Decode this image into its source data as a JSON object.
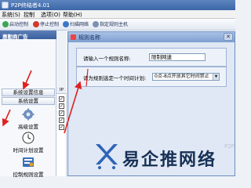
{
  "app": {
    "title": "P2P终结者4.01"
  },
  "menu": [
    "系统(S)",
    "控制",
    "选项(O)",
    "帮助(H)"
  ],
  "toolbar": {
    "buttons": [
      {
        "label": "启动控制",
        "icon": "green-play-icon",
        "color": "#3aa655"
      },
      {
        "label": "停止控制",
        "icon": "red-stop-icon",
        "color": "#d23a2a"
      },
      {
        "label": "扫描网络",
        "icon": "scan-icon",
        "color": "#3d78c7"
      },
      {
        "label": "指定规则主机",
        "icon": "rule-host-icon",
        "color": "#7c8fb3"
      }
    ]
  },
  "sidebar": {
    "header": "惠勤商广告",
    "group_1": "系统设置信息",
    "group_2": "系统设置",
    "items": [
      {
        "label": "高级设置",
        "icon": "advanced-settings-icon"
      },
      {
        "label": "时间计划设置",
        "icon": "clock-icon"
      },
      {
        "label": "控制规则设置",
        "icon": "control-rules-icon"
      }
    ]
  },
  "ip_column": {
    "header": "IP",
    "checks": [
      "✓",
      "✓",
      "✓",
      "✓",
      "✓"
    ]
  },
  "dialog": {
    "title": "规则名称",
    "close": "✕",
    "name_prompt": "请输入一个规则名称:",
    "name_value": "限制网速",
    "plan_prompt": "请为规则选定一个时间计划:",
    "plan_value": "0点-8点开放其它时间禁止"
  },
  "watermark": {
    "text": "易企推网络",
    "faint": "P2P"
  },
  "colors": {
    "arrow": "#e02020",
    "titlebar": "#3b66a8"
  }
}
